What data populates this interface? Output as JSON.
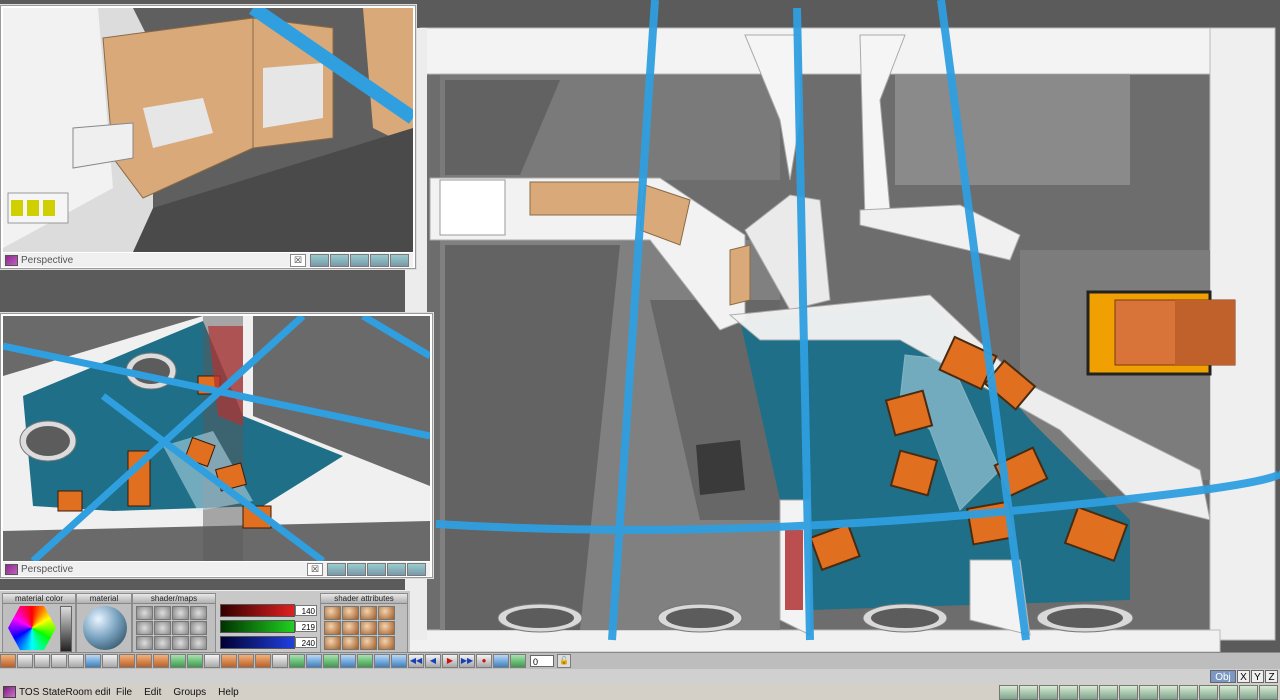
{
  "viewports": {
    "top_left": {
      "title": "Perspective"
    },
    "middle_left": {
      "title": "Perspective"
    },
    "close_glyph": "☒"
  },
  "palette": {
    "headers": {
      "material_color": "material color",
      "material": "material",
      "shader_maps": "shader/maps",
      "shader_attributes": "shader attributes"
    },
    "rgb": {
      "r": "140",
      "g": "219",
      "b": "240"
    }
  },
  "timeline": {
    "frame": "0",
    "play_glyph": "▶",
    "record_glyph": "●",
    "rewind_glyph": "◀◀",
    "ff_glyph": "▶▶",
    "end_glyph": "⏭",
    "lock_glyph": "🔓"
  },
  "objbar": {
    "obj_label": "Obj",
    "x_label": "X",
    "y_label": "Y",
    "z_label": "Z"
  },
  "menubar": {
    "app_title": "TOS StateRoom edit",
    "menus": [
      "File",
      "Edit",
      "Groups",
      "Help"
    ]
  },
  "colors": {
    "floor_teal": "#1e6f87",
    "beam_blue": "#2f9fe0",
    "wall_white": "#f2f2f2",
    "cabinet_tan": "#d9a97a",
    "chair_orange": "#e07020"
  }
}
